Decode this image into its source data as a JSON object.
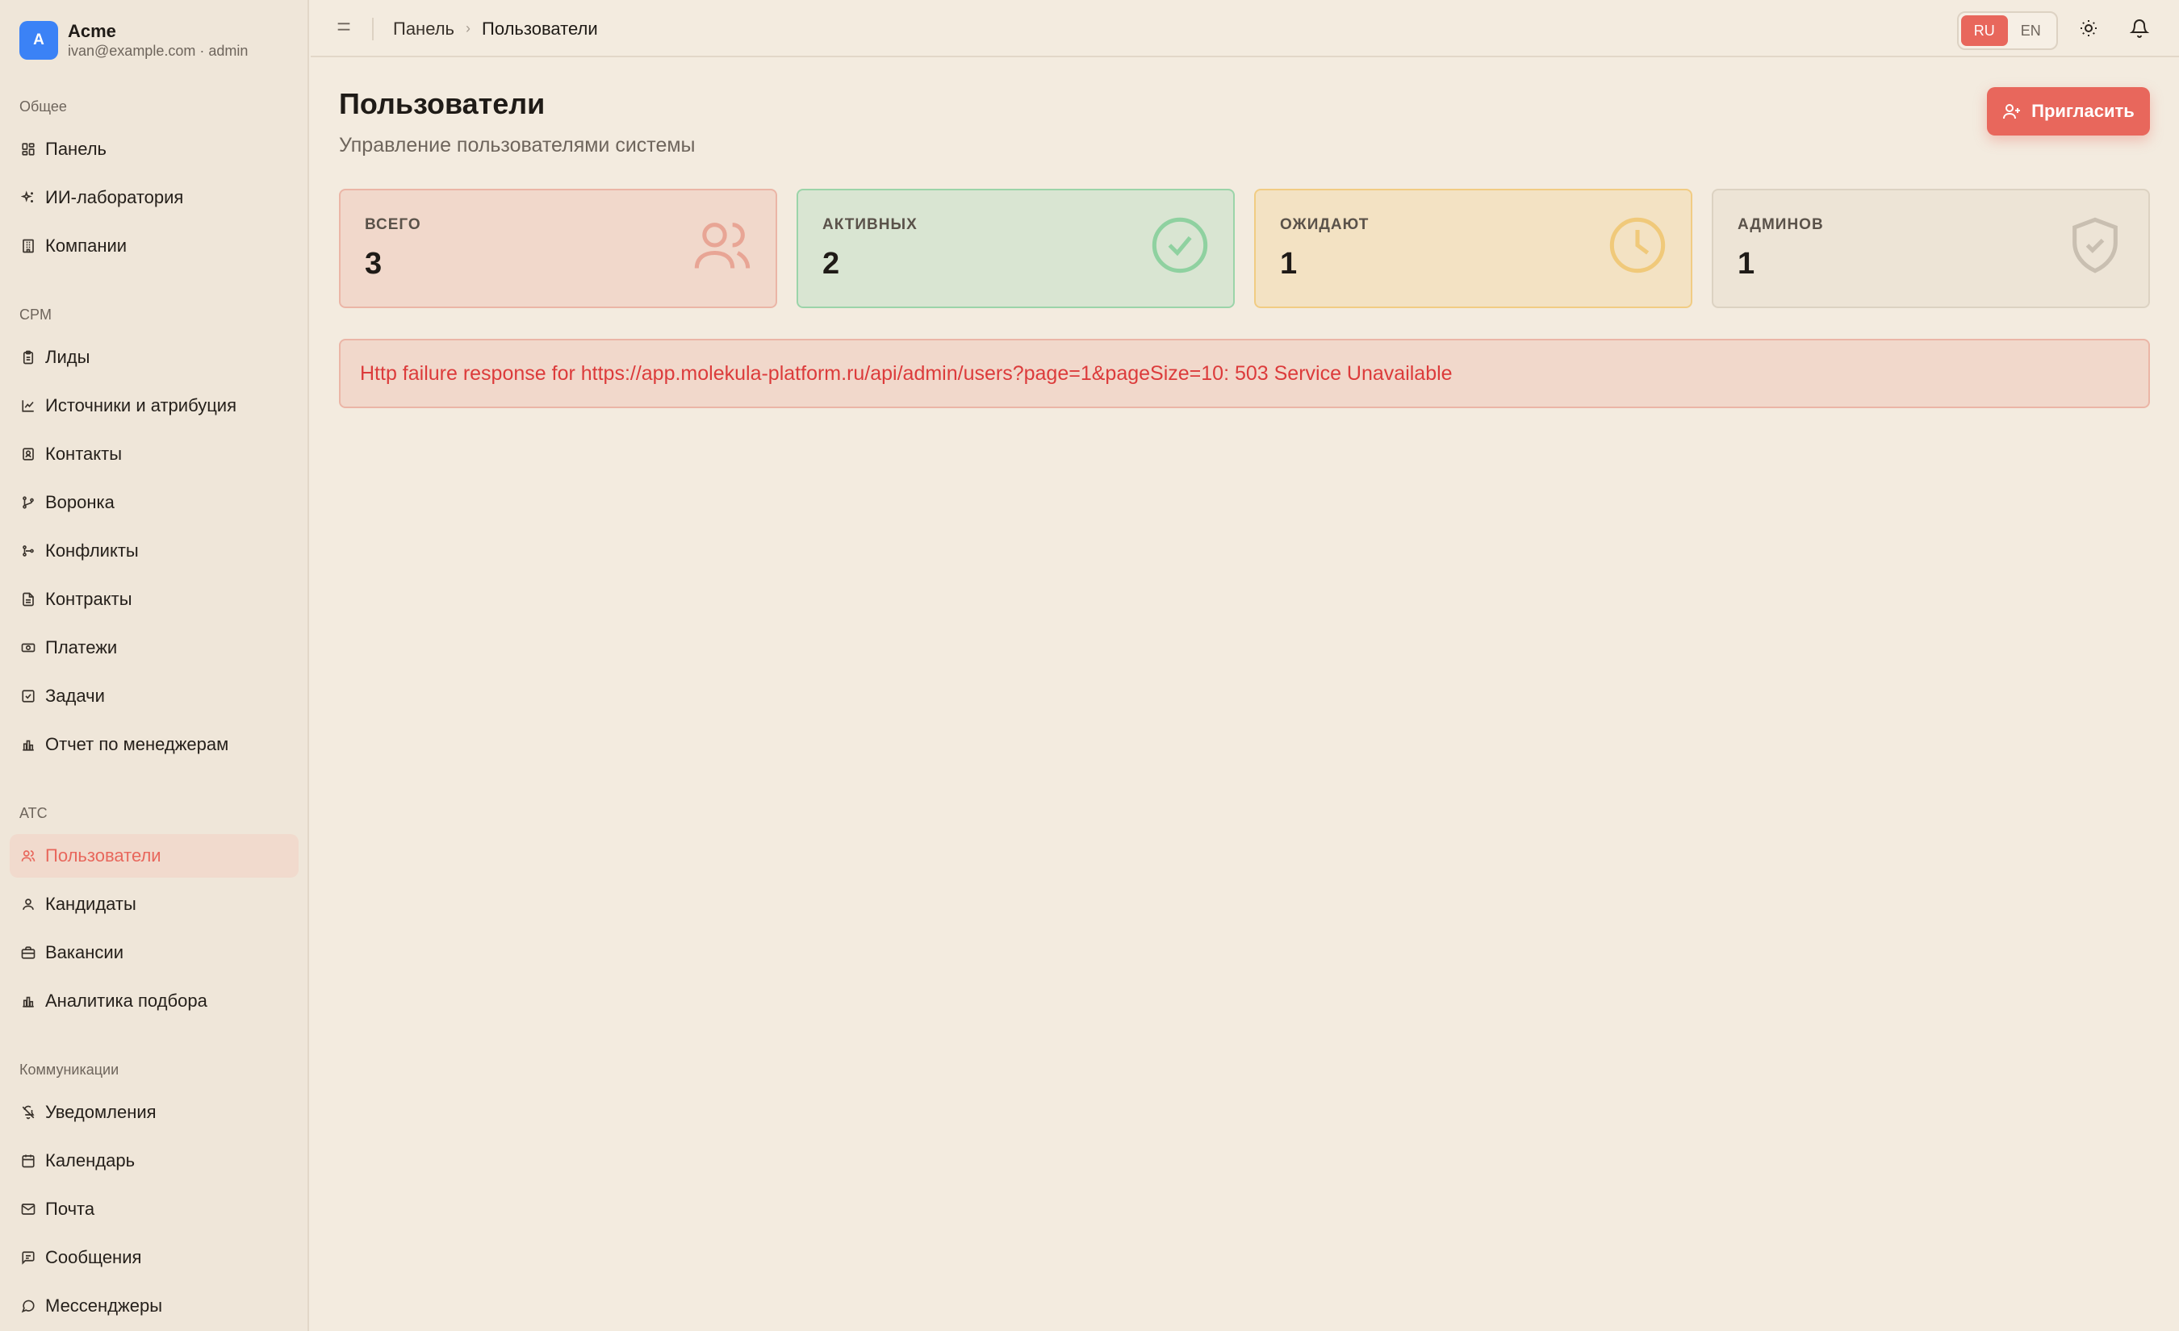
{
  "app": {
    "org_initial": "A",
    "org_name": "Acme",
    "user_line": "ivan@example.com · admin"
  },
  "sidebar": {
    "sections": [
      {
        "title": "Общее",
        "items": [
          {
            "label": "Панель",
            "icon": "dashboard-icon"
          },
          {
            "label": "ИИ-лаборатория",
            "icon": "sparkles-icon"
          },
          {
            "label": "Компании",
            "icon": "building-icon"
          }
        ]
      },
      {
        "title": "CPM",
        "items": [
          {
            "label": "Лиды",
            "icon": "clipboard-icon"
          },
          {
            "label": "Источники и атрибуция",
            "icon": "line-chart-icon"
          },
          {
            "label": "Контакты",
            "icon": "contact-icon"
          },
          {
            "label": "Воронка",
            "icon": "funnel-icon"
          },
          {
            "label": "Конфликты",
            "icon": "git-branch-icon"
          },
          {
            "label": "Контракты",
            "icon": "file-text-icon"
          },
          {
            "label": "Платежи",
            "icon": "banknote-icon"
          },
          {
            "label": "Задачи",
            "icon": "check-square-icon"
          },
          {
            "label": "Отчет по менеджерам",
            "icon": "bar-chart-icon"
          }
        ]
      },
      {
        "title": "ATC",
        "items": [
          {
            "label": "Пользователи",
            "icon": "users-icon",
            "active": true
          },
          {
            "label": "Кандидаты",
            "icon": "user-icon"
          },
          {
            "label": "Вакансии",
            "icon": "briefcase-icon"
          },
          {
            "label": "Аналитика подбора",
            "icon": "bar-chart-icon"
          }
        ]
      },
      {
        "title": "Коммуникации",
        "items": [
          {
            "label": "Уведомления",
            "icon": "bell-off-icon"
          },
          {
            "label": "Календарь",
            "icon": "calendar-icon"
          },
          {
            "label": "Почта",
            "icon": "mail-icon"
          },
          {
            "label": "Сообщения",
            "icon": "message-square-icon"
          },
          {
            "label": "Мессенджеры",
            "icon": "message-circle-icon"
          }
        ]
      }
    ]
  },
  "topbar": {
    "breadcrumb": [
      "Панель",
      "Пользователи"
    ],
    "lang_options": [
      "RU",
      "EN"
    ],
    "lang_selected": "RU"
  },
  "page": {
    "title": "Пользователи",
    "subtitle": "Управление пользователями системы",
    "invite_label": "Пригласить"
  },
  "stats": [
    {
      "label": "ВСЕГО",
      "value": "3",
      "icon": "users-icon",
      "color": "#e8a595"
    },
    {
      "label": "АКТИВНЫХ",
      "value": "2",
      "icon": "check-circle-icon",
      "color": "#8fd1a0"
    },
    {
      "label": "ОЖИДАЮТ",
      "value": "1",
      "icon": "clock-icon",
      "color": "#f0c97a"
    },
    {
      "label": "АДМИНОВ",
      "value": "1",
      "icon": "shield-check-icon",
      "color": "#c9bfb1"
    }
  ],
  "error": {
    "message": "Http failure response for https://app.molekula-platform.ru/api/admin/users?page=1&pageSize=10: 503 Service Unavailable"
  },
  "colors": {
    "accent": "#e8675c",
    "background": "#f3ebdf",
    "error_text": "#dc3b3b"
  }
}
